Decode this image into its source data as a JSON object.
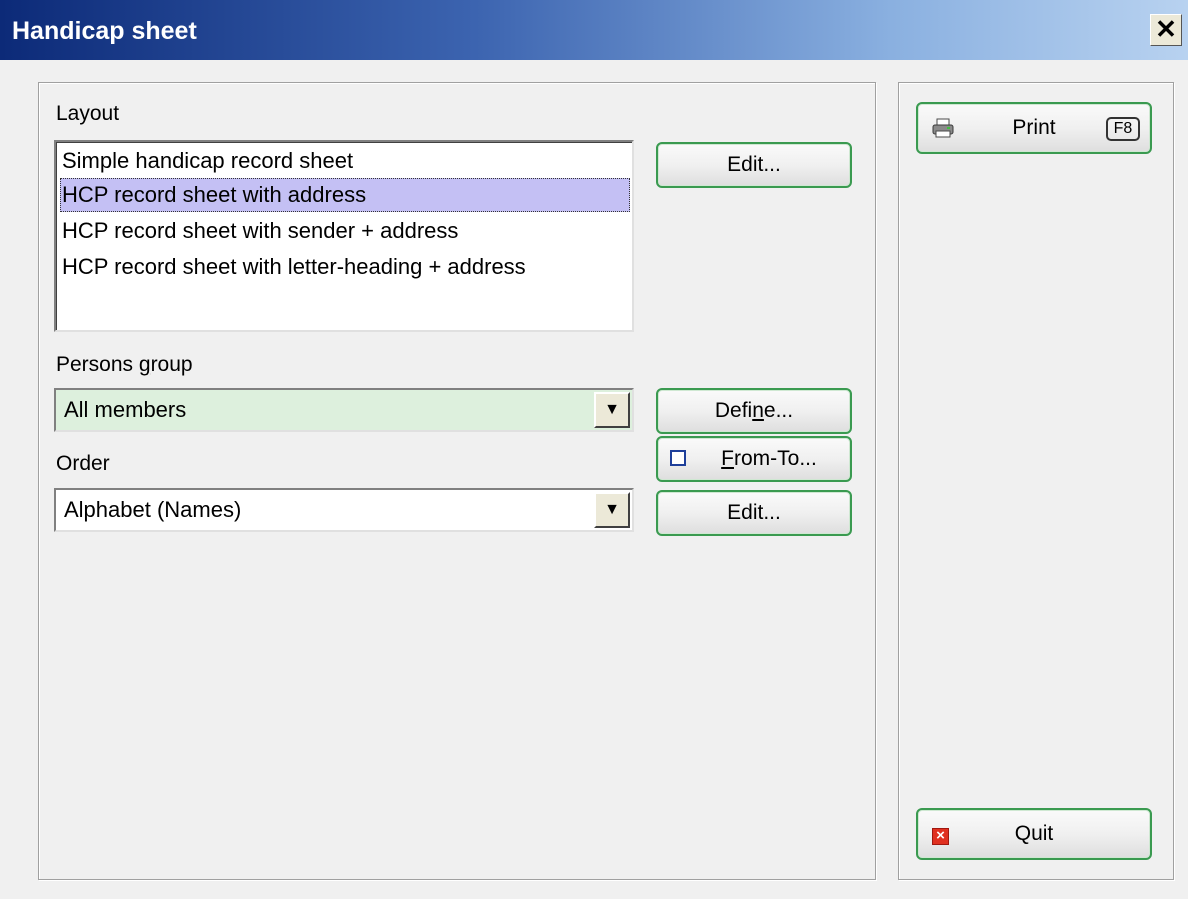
{
  "window": {
    "title": "Handicap sheet",
    "close_glyph": "✕"
  },
  "layout": {
    "label": "Layout",
    "items": [
      {
        "label": "Simple handicap record sheet",
        "selected": false
      },
      {
        "label": "HCP record sheet with address",
        "selected": true
      },
      {
        "label": "HCP record sheet with sender + address",
        "selected": false
      },
      {
        "label": "HCP record sheet with letter-heading + address",
        "selected": false
      }
    ],
    "edit_label": "Edit..."
  },
  "persons_group": {
    "label_pre": "Persons ",
    "label_accel": "g",
    "label_post": "roup",
    "value": "All members",
    "define_pre": "Defi",
    "define_accel": "n",
    "define_post": "e...",
    "from_to_accel": "F",
    "from_to_post": "rom-To..."
  },
  "order": {
    "label": "Order",
    "value": "Alphabet (Names)",
    "edit_label": "Edit..."
  },
  "actions": {
    "print_label": "Print",
    "print_shortcut": "F8",
    "quit_label": "Quit"
  },
  "colors": {
    "selection": "#c4c0f4",
    "combo_highlight": "#ddf0dd",
    "button_border": "#3a9a50"
  },
  "icons": {
    "arrow": "▼"
  }
}
